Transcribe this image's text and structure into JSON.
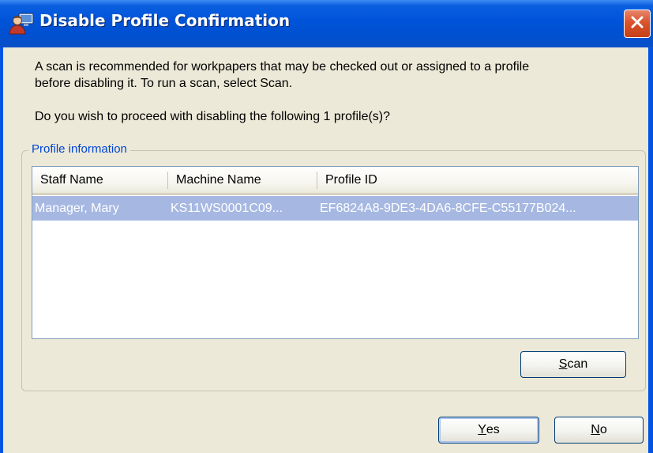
{
  "dialog": {
    "title": "Disable Profile Confirmation",
    "message_line1": "A scan is recommended for workpapers that may be checked out or assigned to a profile",
    "message_line2": "before disabling it. To run a scan, select Scan.",
    "question": "Do you wish to proceed with disabling the following 1 profile(s)?"
  },
  "group": {
    "legend": "Profile information"
  },
  "table": {
    "columns": [
      "Staff Name",
      "Machine Name",
      "Profile ID"
    ],
    "rows": [
      {
        "staff_name": "Manager, Mary",
        "machine_name": "KS11WS0001C09...",
        "profile_id": "EF6824A8-9DE3-4DA6-8CFE-C55177B024..."
      }
    ],
    "selected_row": 0
  },
  "buttons": {
    "scan": {
      "mnemonic": "S",
      "rest": "can"
    },
    "yes": {
      "mnemonic": "Y",
      "rest": "es"
    },
    "no": {
      "mnemonic": "N",
      "rest": "o"
    }
  },
  "icons": {
    "title": "profile-users-icon",
    "close": "close-icon"
  },
  "colors": {
    "title_bar": "#0053d8",
    "dialog_bg": "#ece9d8",
    "selection": "#a6b8e2",
    "legend_text": "#0046d5",
    "close_button": "#d9532d"
  }
}
